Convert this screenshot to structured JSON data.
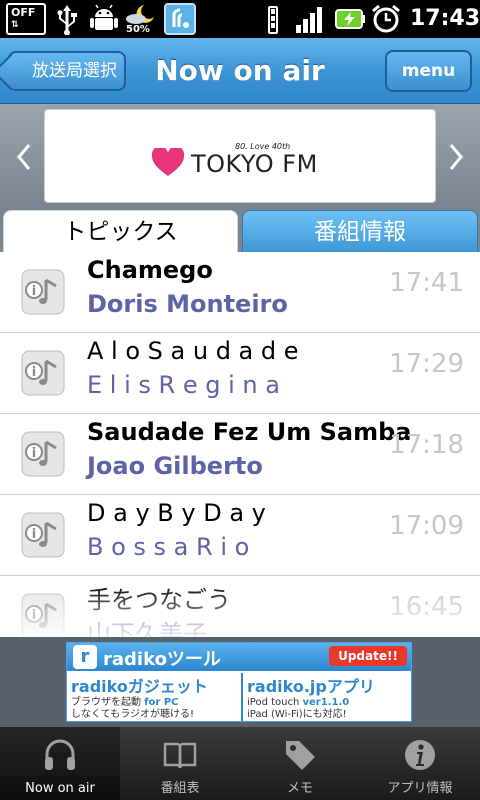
{
  "status_bar": {
    "off_label": "OFF",
    "weather_pct": "50%",
    "time": "17:43",
    "icons": [
      "usb-icon",
      "android-debug-icon",
      "weather-icon",
      "radiko-icon",
      "wifi-icon",
      "signal-icon",
      "battery-charging-icon",
      "alarm-icon"
    ]
  },
  "header": {
    "back_label": "放送局選択",
    "title": "Now on air",
    "menu_label": "menu"
  },
  "station": {
    "name": "TOKYO FM",
    "tagline": "80. Love 40th",
    "brand_color": "#e8347a"
  },
  "tabs": [
    {
      "label": "トピックス",
      "active": true
    },
    {
      "label": "番組情報",
      "active": false
    }
  ],
  "songs": [
    {
      "title": "Chamego",
      "artist": "Doris Monteiro",
      "time": "17:41"
    },
    {
      "title": "A l o S a u d a d e",
      "artist": "E l i s R e g i n a",
      "time": "17:29"
    },
    {
      "title": "Saudade Fez Um Samba",
      "artist": "Joao Gilberto",
      "time": "17:18"
    },
    {
      "title": "D a y B y D a y",
      "artist": "B o s s a R i o",
      "time": "17:09"
    },
    {
      "title": "手をつなごう",
      "artist": "山下久美子",
      "time": "16:45"
    }
  ],
  "ad": {
    "title": "radikoツール",
    "badge": "Update!!",
    "left_title": "radikoガジェット",
    "left_for": "for PC",
    "left_desc_1": "ブラウザを起動",
    "left_desc_2": "しなくてもラジオが聴ける!",
    "right_title": "radiko.jpアプリ",
    "right_version": "ver1.1.0",
    "right_desc_1": "iPod touch",
    "right_desc_2": "iPad (Wi-Fi)にも対応!"
  },
  "bottom_nav": [
    {
      "label": "Now on air",
      "icon": "headphones-icon",
      "active": true
    },
    {
      "label": "番組表",
      "icon": "book-icon",
      "active": false
    },
    {
      "label": "メモ",
      "icon": "tag-icon",
      "active": false
    },
    {
      "label": "アプリ情報",
      "icon": "info-icon",
      "active": false
    }
  ],
  "colors": {
    "header_blue": "#3c93d4",
    "artist_text": "#5d63a7",
    "time_text": "#c7c7c7"
  }
}
